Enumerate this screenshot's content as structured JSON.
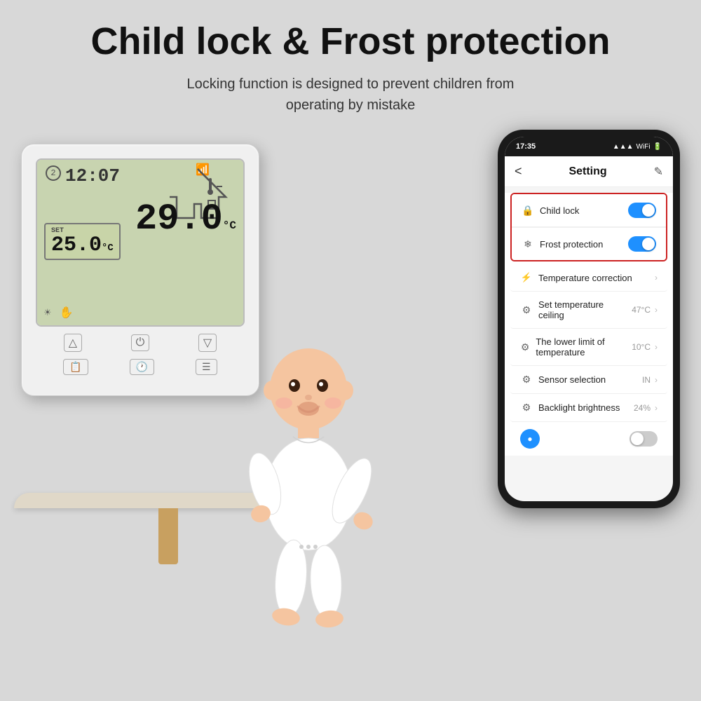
{
  "header": {
    "main_title": "Child lock & Frost protection",
    "subtitle": "Locking function is designed to prevent children from\noperating by mistake"
  },
  "phone": {
    "status_bar": {
      "time": "17:35",
      "icons": "▲ ● ■"
    },
    "app_header": {
      "back": "<",
      "title": "Setting",
      "edit": "✎"
    },
    "highlighted_items": [
      {
        "icon": "🔒",
        "label": "Child lock",
        "toggle": "on"
      },
      {
        "icon": "❄",
        "label": "Frost protection",
        "toggle": "on"
      }
    ],
    "settings_items": [
      {
        "icon": "♨",
        "label": "Temperature correction",
        "value": "",
        "has_chevron": true
      },
      {
        "icon": "⚙",
        "label": "Set temperature ceiling",
        "value": "47°C",
        "has_chevron": true
      },
      {
        "icon": "⚙",
        "label": "The lower limit of temperature",
        "value": "10°C",
        "has_chevron": true
      },
      {
        "icon": "⚙",
        "label": "Sensor selection",
        "value": "IN",
        "has_chevron": true
      },
      {
        "icon": "⚙",
        "label": "Backlight brightness",
        "value": "24%",
        "has_chevron": true
      }
    ],
    "bottom_item": {
      "icon": "●",
      "toggle": "off"
    }
  },
  "thermostat": {
    "time": "12:07",
    "circle_num": "2",
    "set_label": "SET",
    "set_temp": "25.0",
    "set_unit": "°C",
    "main_temp": "29.0",
    "main_unit": "°C"
  }
}
